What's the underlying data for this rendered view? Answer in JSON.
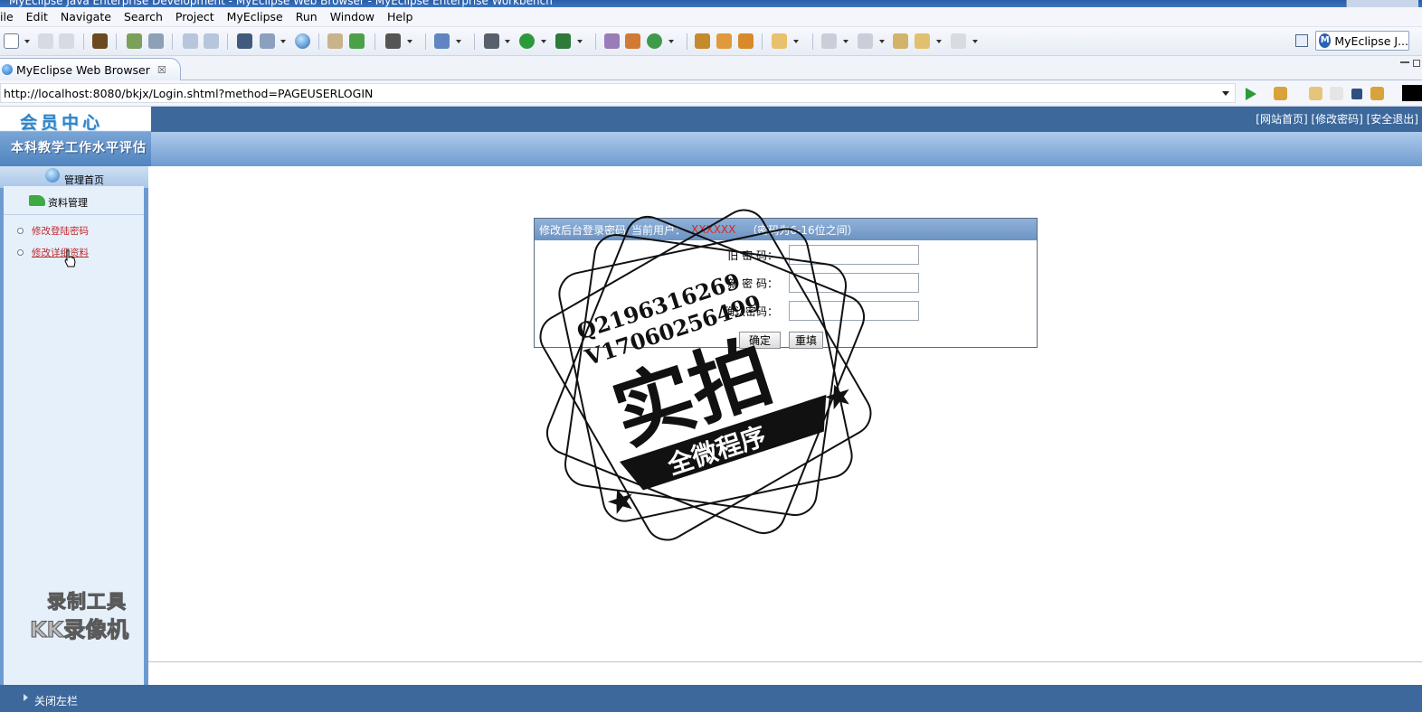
{
  "window": {
    "title": "MyEclipse Java Enterprise Development - MyEclipse Web Browser - MyEclipse Enterprise Workbench"
  },
  "menu": {
    "items": [
      "ile",
      "Edit",
      "Navigate",
      "Search",
      "Project",
      "MyEclipse",
      "Run",
      "Window",
      "Help"
    ]
  },
  "toolbar": {
    "perspective_label": "MyEclipse J..."
  },
  "editor_tab": {
    "label": "MyEclipse Web Browser",
    "close_glyph": "☒"
  },
  "address_bar": {
    "url": "http://localhost:8080/bkjx/Login.shtml?method=PAGEUSERLOGIN"
  },
  "site": {
    "logo": "会员中心",
    "subtitle": "本科教学工作水平评估",
    "top_links": "[网站首页] [修改密码] [安全退出]",
    "sidebar": {
      "home_label": "管理首页",
      "section_label": "资料管理",
      "items": [
        "修改登陆密码",
        "修改详细资料"
      ]
    },
    "bottom_toggle": "关闭左栏"
  },
  "form": {
    "title": "修改后台登录密码",
    "user_prefix": "当前用户：",
    "user_value": "XXXXXX",
    "hint": "（密码为6-16位之间）",
    "old_password_label": "旧 密 码：",
    "new_password_label": "新 密 码：",
    "confirm_label": "确认密码：",
    "submit_label": "确定",
    "reset_label": "重填"
  },
  "overlay": {
    "stamp_line1": "Q2196316269",
    "stamp_line2": "V17060256499",
    "stamp_main": "实拍",
    "stamp_banner": "全微程序",
    "recorder_line1": "录制工具",
    "recorder_line2": "KK录像机"
  },
  "colors": {
    "header_blue": "#3c689c",
    "panel_head": "#7ba0cc",
    "link_red": "#c0282a"
  }
}
